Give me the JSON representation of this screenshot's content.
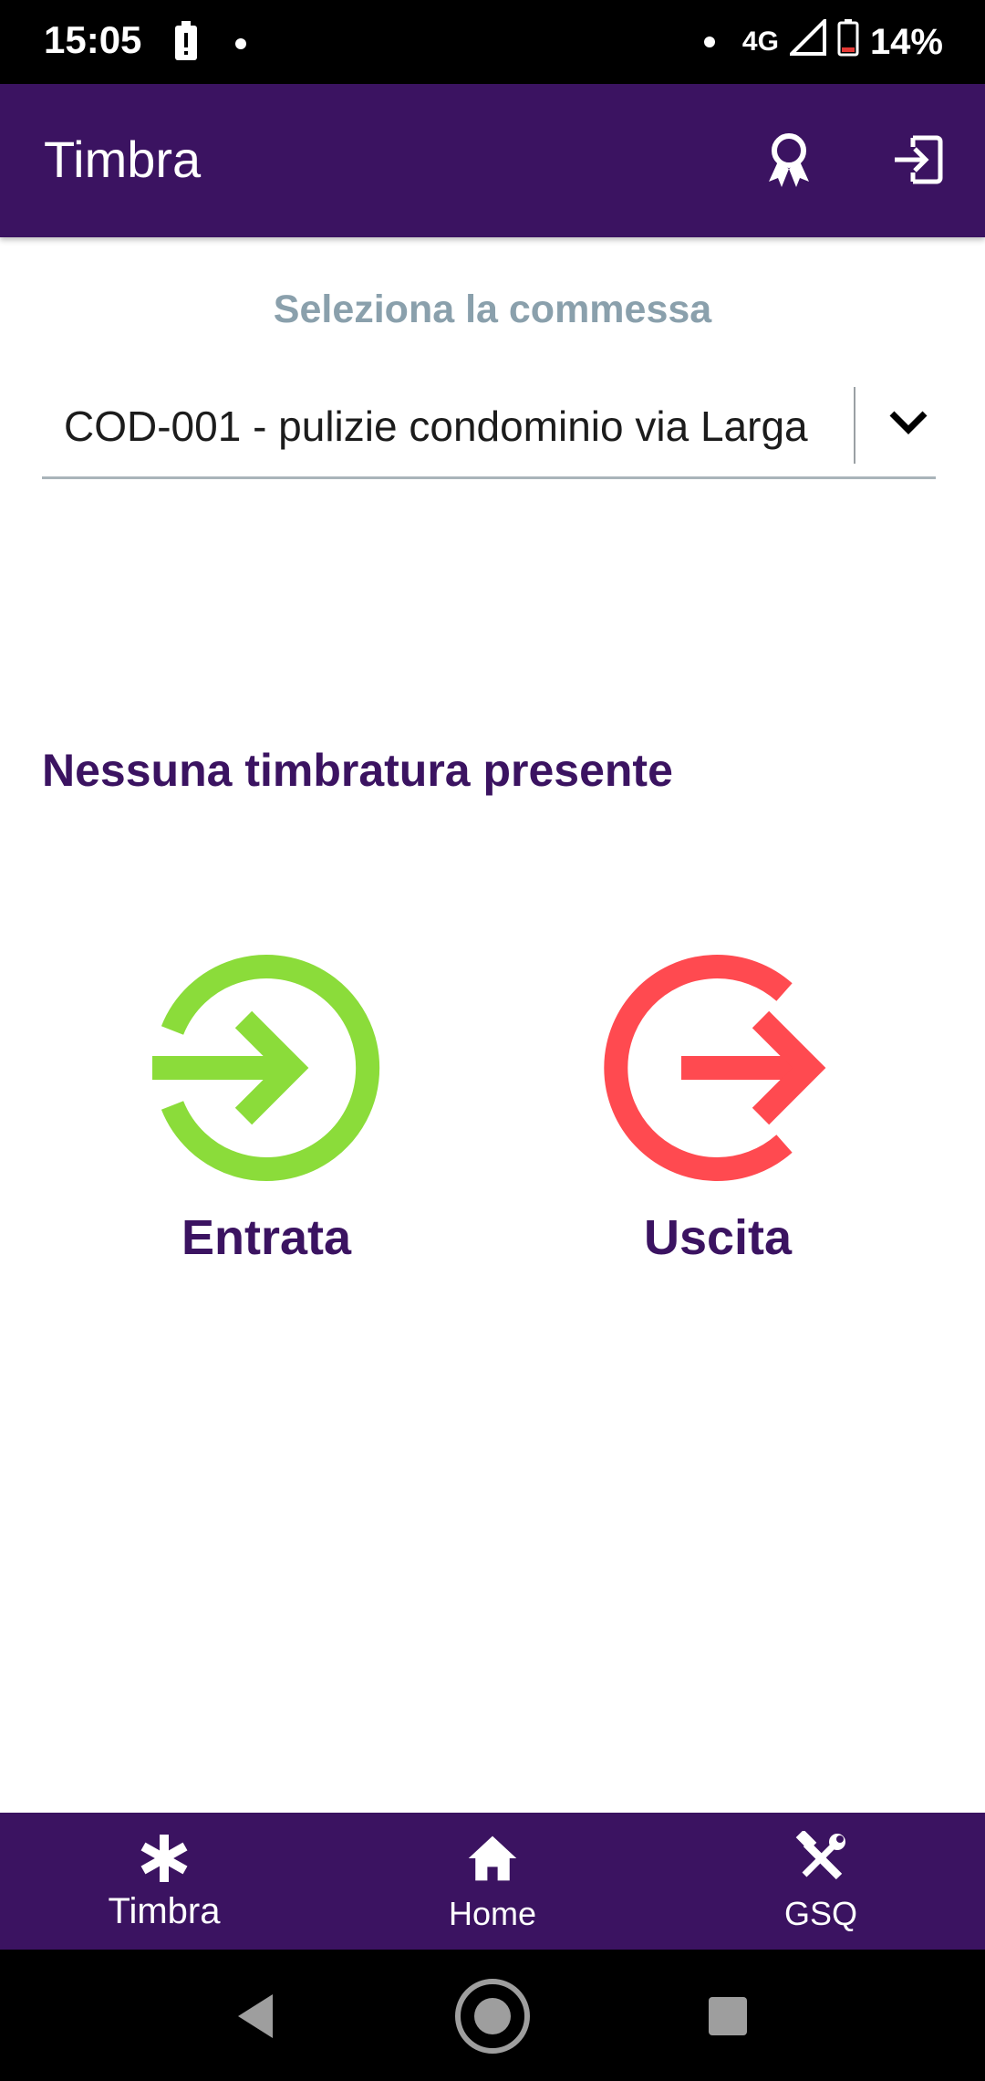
{
  "status_bar": {
    "time": "15:05",
    "network": "4G",
    "battery": "14%"
  },
  "app_bar": {
    "title": "Timbra",
    "background": "#3b1361"
  },
  "select": {
    "label": "Seleziona la commessa",
    "value": "COD-001 - pulizie condominio via Larga"
  },
  "empty_message": "Nessuna timbratura presente",
  "punch": {
    "entry": {
      "label": "Entrata",
      "color": "#8bdc3a",
      "icon": "login-arrow-icon"
    },
    "exit": {
      "label": "Uscita",
      "color": "#ff4a50",
      "icon": "logout-arrow-icon"
    }
  },
  "bottom_nav": {
    "background": "#3b1361",
    "items": [
      {
        "label": "Timbra",
        "icon": "asterisk-icon"
      },
      {
        "label": "Home",
        "icon": "home-icon"
      },
      {
        "label": "GSQ",
        "icon": "tools-icon"
      }
    ]
  }
}
